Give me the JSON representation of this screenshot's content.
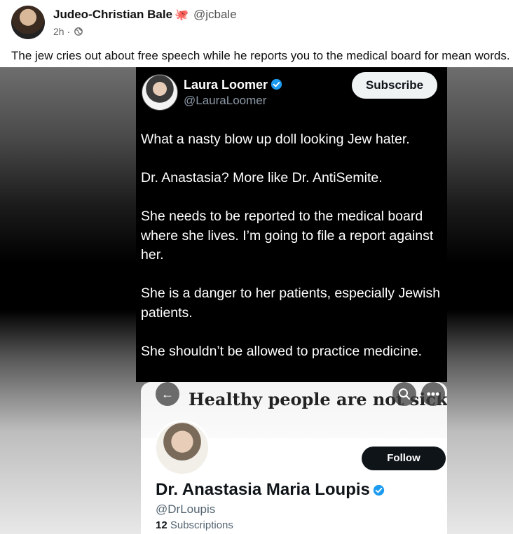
{
  "post": {
    "author_name": "Judeo-Christian Bale",
    "author_emoji_icon": "octopus-icon",
    "author_handle": "@jcbale",
    "time": "2h",
    "separator": "·",
    "audience_icon": "globe-icon",
    "text": "The jew cries out about free speech while he reports you to the medical board for mean words."
  },
  "tweet": {
    "name": "Laura Loomer",
    "handle": "@LauraLoomer",
    "subscribe_label": "Subscribe",
    "verified_color": "#1d9bf0",
    "paragraphs": [
      "What a nasty blow up doll looking Jew hater.",
      "Dr. Anastasia? More like Dr. AntiSemite.",
      "She needs to be reported to the medical board where she lives. I’m going to file a report against her.",
      "She is a danger to her patients, especially Jewish patients.",
      "She shouldn’t be allowed to practice medicine."
    ]
  },
  "profile": {
    "banner_text": "Healthy people are not sick",
    "name": "Dr. Anastasia Maria Loupis",
    "handle": "@DrLoupis",
    "subscriptions_count": "12",
    "subscriptions_label": "Subscriptions",
    "follow_label": "Follow"
  }
}
